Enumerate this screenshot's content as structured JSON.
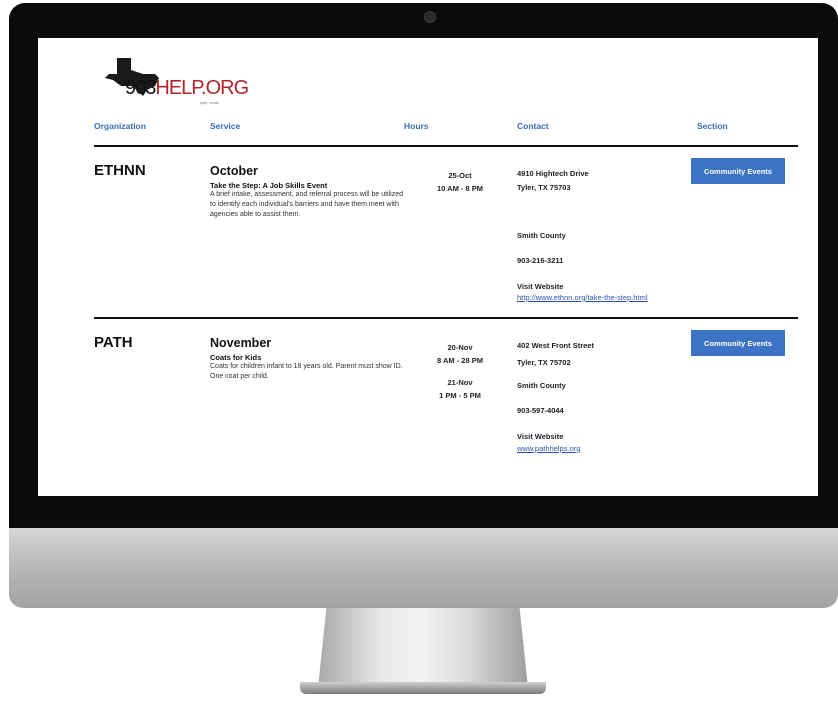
{
  "logo": {
    "part1": "903",
    "part2": "HELP.ORG",
    "tagline": "tyler, texas"
  },
  "columns": {
    "organization": "Organization",
    "service": "Service",
    "hours": "Hours",
    "contact": "Contact",
    "section": "Section"
  },
  "listings": [
    {
      "organization": "ETHNN",
      "month": "October",
      "event_title": "Take the Step: A Job Skills Event",
      "description": "A brief intake, assessment, and referral process will be utilized to identify each individual's barriers and have them meet with agencies able to assist them.",
      "hours": [
        {
          "date": "25-Oct",
          "time": "10 AM - 8 PM"
        }
      ],
      "address1": "4910 Hightech Drive",
      "address2": "Tyler, TX 75703",
      "county": "Smith County",
      "phone": "903-216-3211",
      "website_label": "Visit Website",
      "website_url": "http://www.ethnn.org/take-the-step.html",
      "section": "Community Events"
    },
    {
      "organization": "PATH",
      "month": "November",
      "event_title": "Coats for Kids",
      "description": "Coats for children infant to 18 years old. Parent must show ID. One coat per child.",
      "hours": [
        {
          "date": "20-Nov",
          "time": "8 AM - 28 PM"
        },
        {
          "date": "21-Nov",
          "time": "1 PM - 5 PM"
        }
      ],
      "address1": "402 West Front Street",
      "address2": "Tyler, TX 75702",
      "county": "Smith County",
      "phone": "903-597-4044",
      "website_label": "Visit Website",
      "website_url": "www.pathhelps.org",
      "section": "Community Events"
    }
  ],
  "colors": {
    "accent": "#3d73c4",
    "logo_red": "#b0242c",
    "header_blue": "#3a6bb5"
  }
}
